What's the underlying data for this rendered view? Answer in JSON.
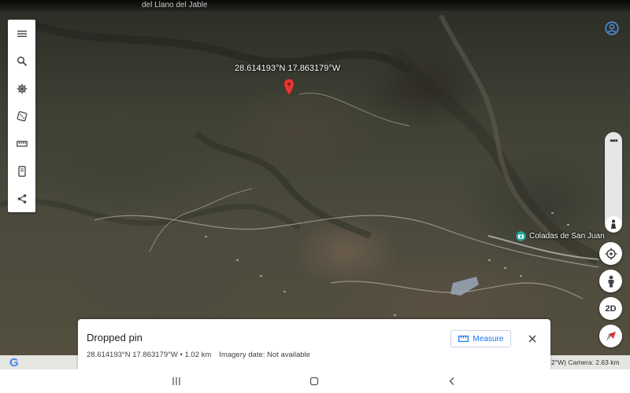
{
  "map": {
    "top_place_label": "del Llano del Jable",
    "pin_coordinates": "28.614193°N 17.863179°W",
    "place_name": "Coladas de San Juan"
  },
  "toolbar": {
    "items": [
      {
        "icon": "menu-icon"
      },
      {
        "icon": "search-icon"
      },
      {
        "icon": "voyager-icon"
      },
      {
        "icon": "feeling-lucky-dice-icon"
      },
      {
        "icon": "measure-ruler-icon"
      },
      {
        "icon": "projects-icon"
      },
      {
        "icon": "share-icon"
      }
    ]
  },
  "controls": {
    "more_label": "•••",
    "view_2d_label": "2D"
  },
  "card": {
    "title": "Dropped pin",
    "coordinates": "28.614193°N 17.863179°W",
    "separator": " • ",
    "distance": "1.02 km",
    "imagery": "Imagery date: Not available",
    "measure_label": "Measure"
  },
  "attribution": {
    "text": "2°W) Camera: 2.63 km"
  },
  "colors": {
    "accent": "#1a73e8",
    "pin": "#e53935"
  }
}
